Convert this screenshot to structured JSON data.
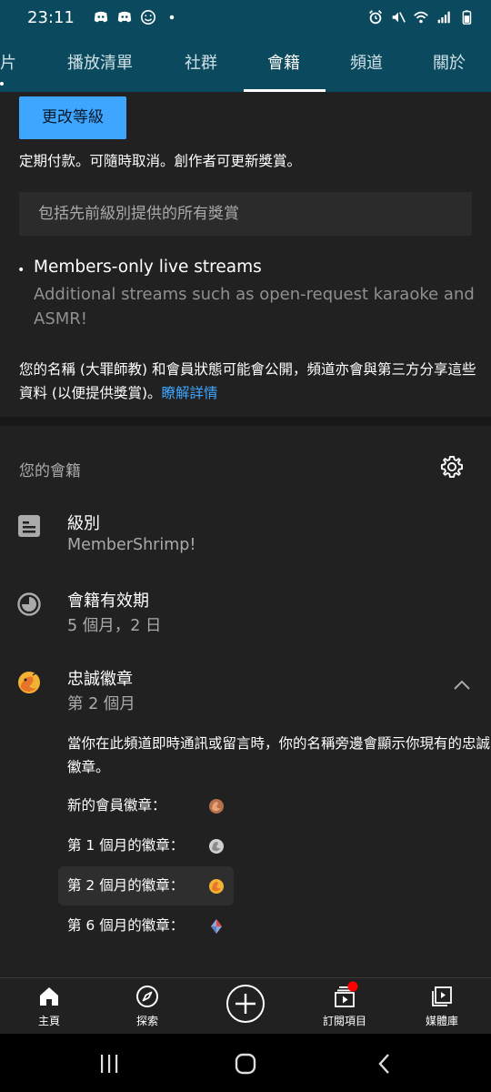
{
  "status_bar": {
    "time": "23:11"
  },
  "tabs": [
    {
      "label": "片"
    },
    {
      "label": "播放清單"
    },
    {
      "label": "社群"
    },
    {
      "label": "會籍"
    },
    {
      "label": "頻道"
    },
    {
      "label": "關於"
    }
  ],
  "membership_card": {
    "change_tier_button": "更改等級",
    "billing_note": "定期付款。可隨時取消。創作者可更新獎賞。",
    "includes_rewards": "包括先前級別提供的所有獎賞",
    "perk_title": "Members-only live streams",
    "perk_description": "Additional streams such as open-request karaoke and ASMR!",
    "privacy_note": "您的名稱 (大罪師教) 和會員狀態可能會公開，頻道亦會與第三方分享這些資料 (以便提供獎賞)。",
    "learn_more": "瞭解詳情"
  },
  "your_membership": {
    "title": "您的會籍",
    "tier_label": "級別",
    "tier_value": "MemberShrimp!",
    "validity_label": "會籍有效期",
    "validity_value": "5 個月，2 日",
    "loyalty_label": "忠誠徽章",
    "loyalty_value": "第 2 個月",
    "loyalty_note": "當你在此頻道即時通訊或留言時，你的名稱旁邊會顯示你現有的忠誠徽章。",
    "badges": [
      {
        "label": "新的會員徽章："
      },
      {
        "label": "第 1 個月的徽章："
      },
      {
        "label": "第 2 個月的徽章："
      },
      {
        "label": "第 6 個月的徽章："
      }
    ]
  },
  "bottom_nav": {
    "home": "主頁",
    "explore": "探索",
    "subscriptions": "訂閱項目",
    "library": "媒體庫"
  },
  "colors": {
    "header_bg": "#0b4a5e",
    "accent_blue": "#3ea6ff",
    "background": "#212121",
    "notification_red": "#ff0000"
  }
}
